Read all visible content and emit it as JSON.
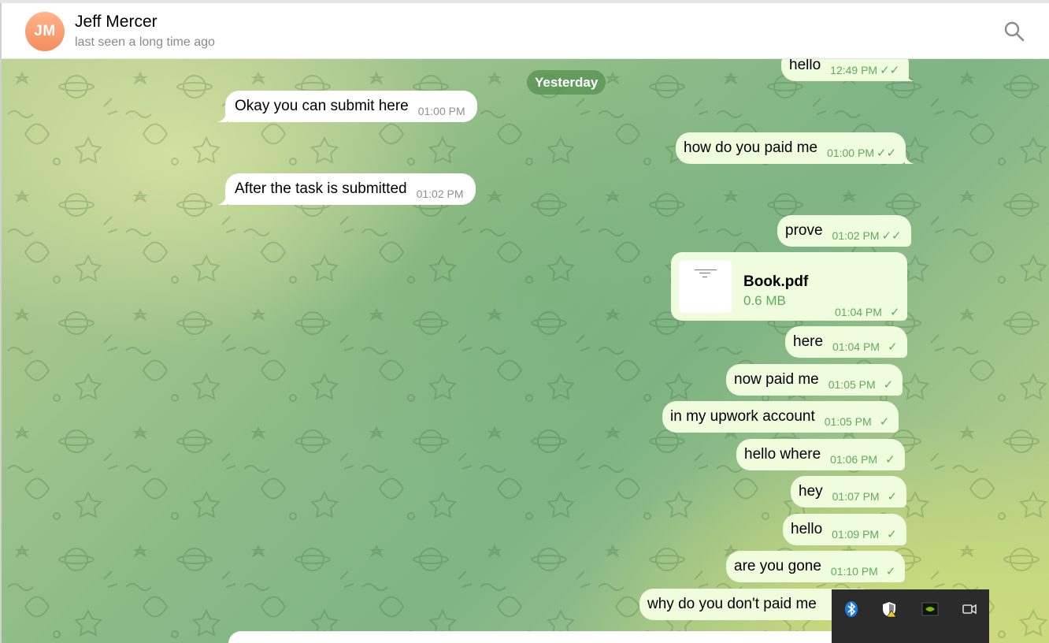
{
  "header": {
    "avatar_initials": "JM",
    "peer_name": "Jeff Mercer",
    "peer_status": "last seen a long time ago",
    "search_icon": "search-icon"
  },
  "chat": {
    "date_separator": "Yesterday",
    "messages": [
      {
        "dir": "out",
        "text": "hello",
        "time": "12:49 PM",
        "ticks": "read"
      },
      {
        "dir": "in",
        "text": "Okay you can submit here",
        "time": "01:00 PM"
      },
      {
        "dir": "out",
        "text": "how do you paid me",
        "time": "01:00 PM",
        "ticks": "read"
      },
      {
        "dir": "in",
        "text": "After the task is submitted",
        "time": "01:02 PM"
      },
      {
        "dir": "out",
        "text": "prove",
        "time": "01:02 PM",
        "ticks": "read"
      },
      {
        "dir": "out",
        "type": "file",
        "file_name": "Book.pdf",
        "file_size": "0.6 MB",
        "time": "01:04 PM",
        "ticks": "sent"
      },
      {
        "dir": "out",
        "text": "here",
        "time": "01:04 PM",
        "ticks": "sent"
      },
      {
        "dir": "out",
        "text": "now paid me",
        "time": "01:05 PM",
        "ticks": "sent"
      },
      {
        "dir": "out",
        "text": "in my upwork account",
        "time": "01:05 PM",
        "ticks": "sent"
      },
      {
        "dir": "out",
        "text": "hello where",
        "time": "01:06 PM",
        "ticks": "sent"
      },
      {
        "dir": "out",
        "text": "hey",
        "time": "01:07 PM",
        "ticks": "sent"
      },
      {
        "dir": "out",
        "text": "hello",
        "time": "01:09 PM",
        "ticks": "sent"
      },
      {
        "dir": "out",
        "text": "are you gone",
        "time": "01:10 PM",
        "ticks": "sent"
      },
      {
        "dir": "out",
        "text": "why do you don't paid me",
        "time": "",
        "ticks": "sent"
      }
    ]
  },
  "tray": {
    "icons": [
      "bluetooth-icon",
      "security-warning-icon",
      "nvidia-icon",
      "camera-icon"
    ]
  },
  "colors": {
    "outgoing_bubble": "#effdde",
    "incoming_bubble": "#ffffff",
    "accent_green": "#5fab5a",
    "date_pill": "#6a9e63",
    "avatar": "#f79b6e"
  }
}
